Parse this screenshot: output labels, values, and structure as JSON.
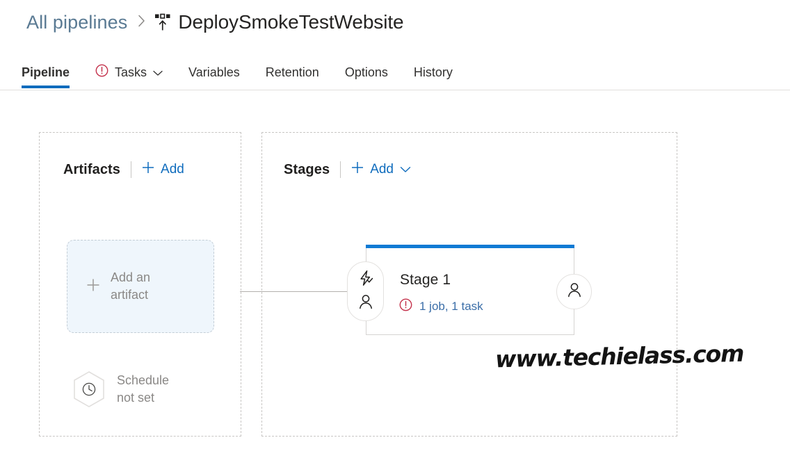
{
  "breadcrumb": {
    "parent_label": "All pipelines",
    "separator": "›",
    "pipeline_icon": "release-icon",
    "title": "DeploySmokeTestWebsite"
  },
  "tabs": [
    {
      "label": "Pipeline",
      "active": true,
      "has_warning": false,
      "has_chevron": false
    },
    {
      "label": "Tasks",
      "active": false,
      "has_warning": true,
      "has_chevron": true
    },
    {
      "label": "Variables",
      "active": false,
      "has_warning": false,
      "has_chevron": false
    },
    {
      "label": "Retention",
      "active": false,
      "has_warning": false,
      "has_chevron": false
    },
    {
      "label": "Options",
      "active": false,
      "has_warning": false,
      "has_chevron": false
    },
    {
      "label": "History",
      "active": false,
      "has_warning": false,
      "has_chevron": false
    }
  ],
  "artifacts": {
    "title": "Artifacts",
    "add_label": "Add",
    "add_artifact_line1": "Add an",
    "add_artifact_line2": "artifact",
    "schedule_line1": "Schedule",
    "schedule_line2": "not set",
    "schedule_icon": "clock-icon"
  },
  "stages": {
    "title": "Stages",
    "add_label": "Add",
    "stage": {
      "name": "Stage 1",
      "status_text": "1 job, 1 task",
      "status_icon": "warning-circle-icon",
      "predeploy_icons": [
        "lightning-bolt-icon",
        "person-icon"
      ],
      "postdeploy_icon": "person-icon"
    }
  },
  "watermark": {
    "text": "www.techielass.com"
  },
  "colors": {
    "accent_blue": "#0f6cbd",
    "stage_bar_blue": "#0f7ad4",
    "link_blue": "#3b6ea8",
    "warning_red": "#c4314b",
    "breadcrumb_link": "#5a7a93",
    "muted_text": "#8a8886",
    "dashed_border": "#c8c6c4",
    "artifact_box_fill": "#eff6fc"
  }
}
